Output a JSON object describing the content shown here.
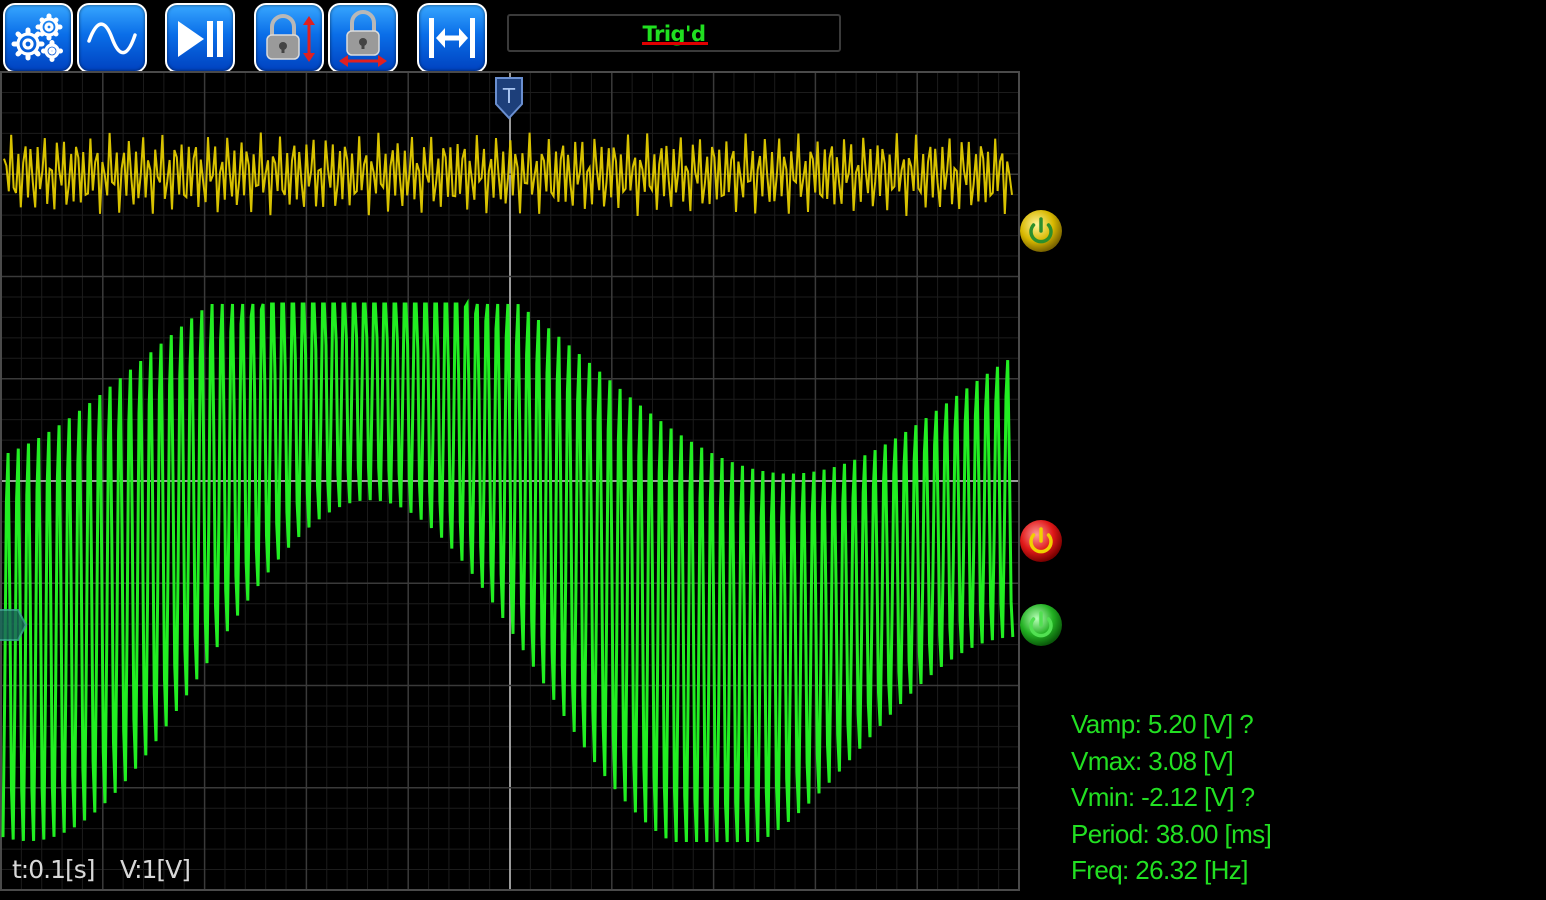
{
  "toolbar": {
    "buttons": [
      {
        "id": "settings",
        "icon": "gears-icon"
      },
      {
        "id": "waveform",
        "icon": "sine-wave-icon"
      },
      {
        "id": "run-pause",
        "icon": "play-pause-icon"
      },
      {
        "id": "lock-vertical",
        "icon": "lock-vertical-icon"
      },
      {
        "id": "lock-horizontal",
        "icon": "lock-horizontal-icon"
      },
      {
        "id": "fit-horizontal",
        "icon": "expand-horizontal-icon"
      }
    ]
  },
  "status": {
    "text": "Trig'd",
    "text_color": "#20e020",
    "underline_color": "#e00000"
  },
  "scope": {
    "background": "#000000",
    "grid_color": "#3a3a3a",
    "center_line_color": "#9a9a9a",
    "trigger_marker_label": "T",
    "channels": [
      {
        "id": "ch1",
        "color": "#d8c200",
        "marker_color": "#e0c000"
      },
      {
        "id": "ch2",
        "color": "#22ee22",
        "marker_color": "#22c022"
      }
    ],
    "trigger_level_marker_color": "#e02020"
  },
  "scale": {
    "time": "t:0.1[s]",
    "volt": "V:1[V]"
  },
  "measurements": {
    "vamp": "Vamp: 5.20 [V] ?",
    "vmax": "Vmax: 3.08 [V]",
    "vmin": "Vmin: -2.12 [V] ?",
    "period": "Period: 38.00 [ms]",
    "freq": "Freq: 26.32 [Hz]"
  }
}
